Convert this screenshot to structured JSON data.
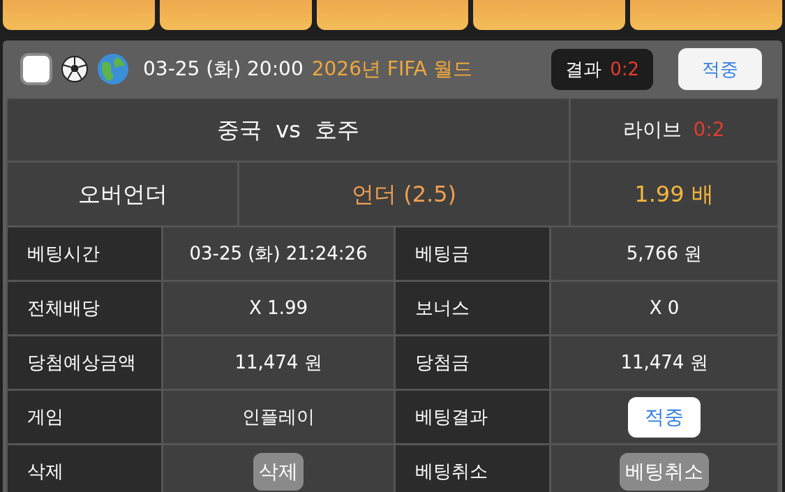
{
  "top_buttons": [
    {
      "kind": "action"
    },
    {
      "kind": "action"
    },
    {
      "kind": "action"
    },
    {
      "kind": "action"
    },
    {
      "kind": "action"
    }
  ],
  "bet": {
    "checked": false,
    "datetime": "03-25 (화) 20:00",
    "league": "2026년 FIFA 월드",
    "result_label": "결과",
    "result_score": "0:2",
    "status": "적중",
    "match": "중국  vs  호주",
    "live_label": "라이브",
    "live_score": "0:2",
    "market": "오버언더",
    "pick": "언더 (2.5)",
    "odds": "1.99 배",
    "details": [
      {
        "cells": [
          {
            "label": "베팅시간",
            "value": "03-25 (화) 21:24:26",
            "kind": "text"
          },
          {
            "label": "베팅금",
            "value": "5,766 원",
            "kind": "text"
          }
        ]
      },
      {
        "cells": [
          {
            "label": "전체배당",
            "value": "X 1.99",
            "kind": "text"
          },
          {
            "label": "보너스",
            "value": "X 0",
            "kind": "text"
          }
        ]
      },
      {
        "cells": [
          {
            "label": "당첨예상금액",
            "value": "11,474 원",
            "kind": "text"
          },
          {
            "label": "당첨금",
            "value": "11,474 원",
            "kind": "text"
          }
        ]
      },
      {
        "cells": [
          {
            "label": "게임",
            "value": "인플레이",
            "kind": "text"
          },
          {
            "label": "베팅결과",
            "value": "적중",
            "kind": "status"
          }
        ]
      },
      {
        "cells": [
          {
            "label": "삭제",
            "value": "삭제",
            "kind": "button"
          },
          {
            "label": "베팅취소",
            "value": "베팅취소",
            "kind": "button"
          }
        ]
      }
    ]
  }
}
